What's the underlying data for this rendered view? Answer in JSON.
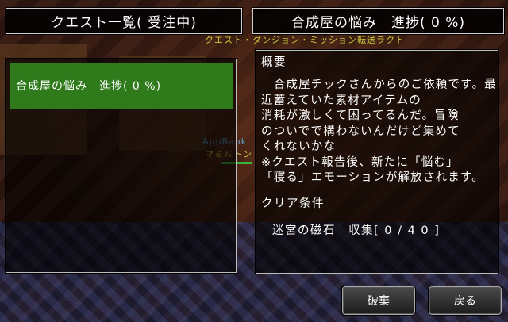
{
  "left_panel": {
    "title": "クエスト一覧( 受注中)",
    "quests": [
      {
        "label": "合成屋の悩み　進捗( 0 %)",
        "selected": true
      }
    ]
  },
  "right_panel": {
    "title": "合成屋の悩み　進捗( 0 %)",
    "overview_heading": "概要",
    "description_lines": [
      "　合成屋チックさんからのご依頼です。最近蓄えていた素材アイテムの",
      "消耗が激しくて困ってるんだ。冒険",
      "のついでで構わないんだけど集めて",
      "くれないかな",
      "※クエスト報告後、新たに「悩む」",
      "「寝る」エモーションが解放されます。"
    ],
    "clear_heading": "クリア条件",
    "clear_condition": "迷宮の磁石　収集[ 0 / 4 0 ]"
  },
  "buttons": {
    "discard_label": "破棄",
    "back_label": "戻る"
  },
  "world_overlay": {
    "quest_banner": "クエスト・ダンジョン・ミッション転送ラクト",
    "player_tag": "AppBank",
    "npc_name": "マミルトン"
  },
  "colors": {
    "selected_quest_bg": "#2f7a1b",
    "banner_text": "#c9c93a",
    "player_tag_text": "#5aa0c8",
    "npc_name_text": "#c9c93a"
  }
}
